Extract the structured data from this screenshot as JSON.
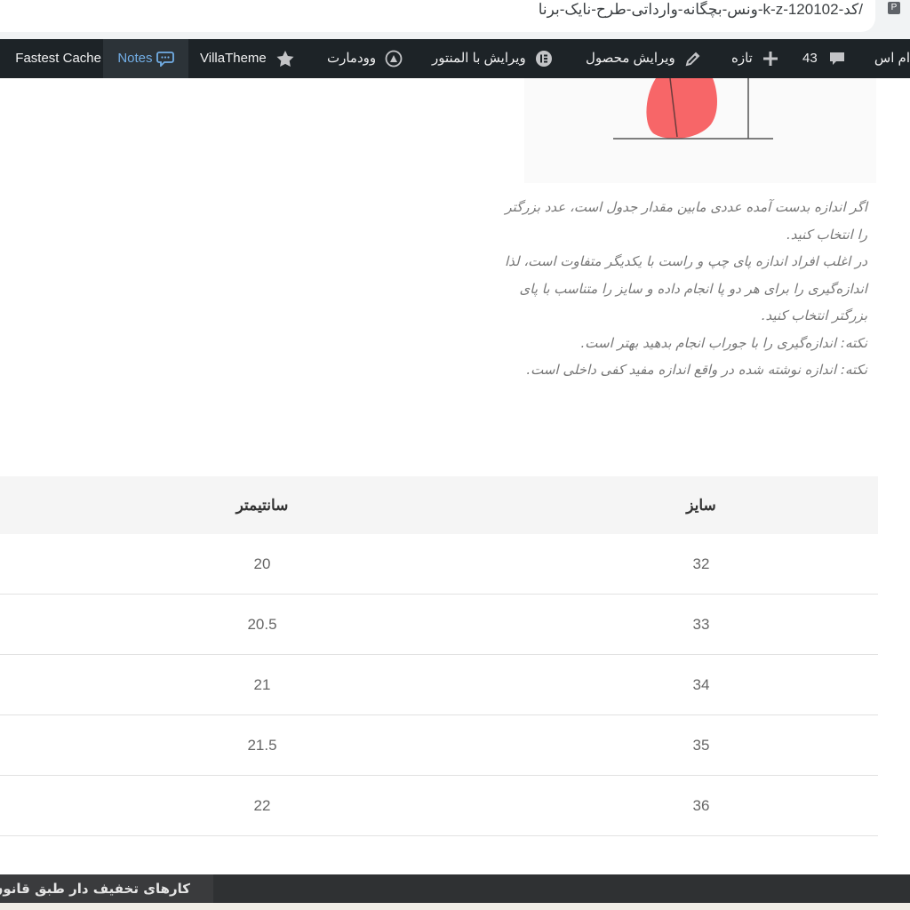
{
  "browser": {
    "url": "/کد-k-z-120102-ونس-بچگانه-وارداتی-طرح-نایک-برنا",
    "extension_label": "P"
  },
  "adminbar": {
    "items": [
      {
        "label": "Fastest Cache",
        "icon": null
      },
      {
        "label": "Notes",
        "icon": "speech-bubble-icon",
        "active": true
      },
      {
        "label": "VillaTheme",
        "icon": "star-icon"
      },
      {
        "label": "وودمارت",
        "icon": "woodmart-logo-icon"
      },
      {
        "label": "ویرایش با المنتور",
        "icon": "elementor-icon"
      },
      {
        "label": "ویرایش محصول",
        "icon": "pencil-icon"
      },
      {
        "label": "تازه",
        "icon": "plus-icon"
      },
      {
        "label": "43",
        "icon": "comment-icon"
      },
      {
        "label": "ام اس",
        "icon": null
      }
    ],
    "colors": {
      "background": "#1d2327",
      "text": "#f0f0f1",
      "active_text": "#72aee6"
    }
  },
  "description": [
    "اگر اندازه بدست آمده عددی مابین مقدار جدول است، عدد بزرگتر را انتخاب کنید.",
    "در اغلب افراد اندازه پای چپ و راست با یکدیگر متفاوت است، لذا اندازه‌گیری را برای هر دو پا انجام داده و سایز را متناسب با پای بزرگتر انتخاب کنید.",
    "نکته: اندازه‌گیری را با جوراب انجام بدهید بهتر است.",
    "نکته: اندازه نوشته شده در واقع اندازه مفید کفی داخلی است."
  ],
  "size_table": {
    "headers": [
      "سایز",
      "سانتیمتر"
    ],
    "rows": [
      [
        "32",
        "20"
      ],
      [
        "33",
        "20.5"
      ],
      [
        "34",
        "21"
      ],
      [
        "35",
        "21.5"
      ],
      [
        "36",
        "22"
      ]
    ]
  },
  "footer": {
    "label": "کارهای تخفیف دار طبق قانون"
  }
}
